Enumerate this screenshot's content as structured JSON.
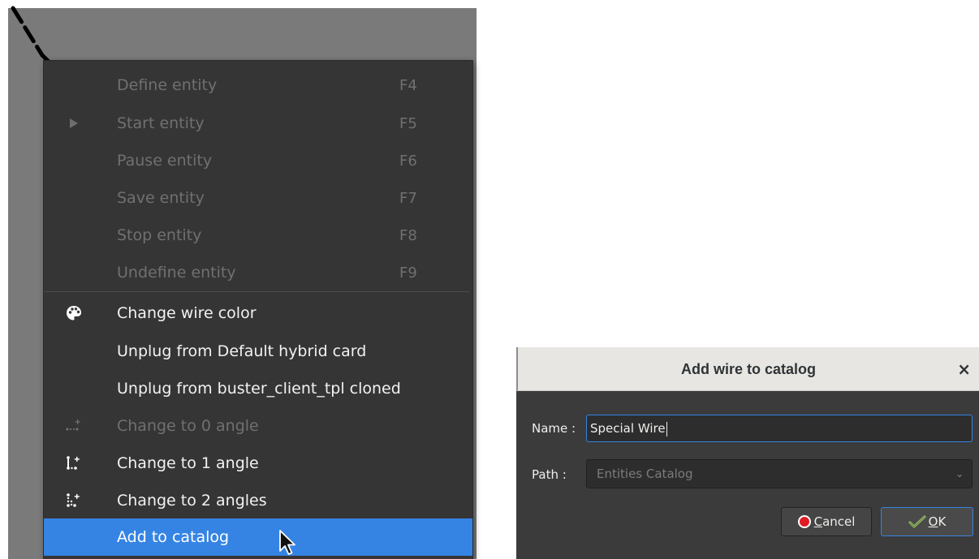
{
  "context_menu": {
    "items": [
      {
        "label": "Define entity",
        "shortcut": "F4",
        "icon": "",
        "disabled": true
      },
      {
        "label": "Start entity",
        "shortcut": "F5",
        "icon": "play-icon",
        "disabled": true
      },
      {
        "label": "Pause entity",
        "shortcut": "F6",
        "icon": "",
        "disabled": true
      },
      {
        "label": "Save entity",
        "shortcut": "F7",
        "icon": "",
        "disabled": true
      },
      {
        "label": "Stop entity",
        "shortcut": "F8",
        "icon": "",
        "disabled": true
      },
      {
        "label": "Undefine entity",
        "shortcut": "F9",
        "icon": "",
        "disabled": true
      },
      {
        "label": "Change wire color",
        "shortcut": "",
        "icon": "palette-icon",
        "disabled": false
      },
      {
        "label": "Unplug from Default hybrid card",
        "shortcut": "",
        "icon": "",
        "disabled": false
      },
      {
        "label": "Unplug from buster_client_tpl cloned",
        "shortcut": "",
        "icon": "",
        "disabled": false
      },
      {
        "label": "Change to 0 angle",
        "shortcut": "",
        "icon": "angle-0-icon",
        "disabled": true
      },
      {
        "label": "Change to 1 angle",
        "shortcut": "",
        "icon": "angle-1-icon",
        "disabled": false
      },
      {
        "label": "Change to 2 angles",
        "shortcut": "",
        "icon": "angle-2-icon",
        "disabled": false
      },
      {
        "label": "Add to catalog",
        "shortcut": "",
        "icon": "",
        "disabled": false,
        "highlighted": true
      }
    ]
  },
  "dialog": {
    "title": "Add wire to catalog",
    "close_icon": "×",
    "name_label": "Name :",
    "name_value": "Special Wire",
    "path_label": "Path :",
    "path_value": "Entities Catalog",
    "path_chevron": "⌄",
    "cancel_label": "Cancel",
    "cancel_mnemonic": "C",
    "cancel_rest": "ancel",
    "ok_label": "OK",
    "ok_mnemonic": "O",
    "ok_rest": "K"
  },
  "colors": {
    "menu_bg": "#353535",
    "highlight": "#3584e4",
    "canvas": "#7a7a7a",
    "dialog_bg": "#3b3b3b"
  }
}
